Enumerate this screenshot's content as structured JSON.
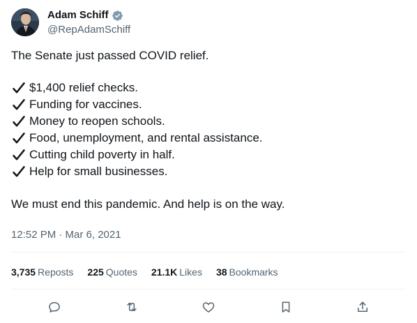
{
  "author": {
    "display_name": "Adam Schiff",
    "handle": "@RepAdamSchiff",
    "avatar_icon": "profile-photo",
    "verified_icon": "verified-badge-icon",
    "verified_color": "#829aab"
  },
  "tweet": {
    "intro": "The Senate just passed COVID relief.",
    "checklist": [
      "$1,400 relief checks.",
      "Funding for vaccines.",
      "Money to reopen schools.",
      "Food, unemployment, and rental assistance.",
      "Cutting child poverty in half.",
      "Help for small businesses."
    ],
    "check_icon": "heavy-check-mark-icon",
    "outro": "We must end this pandemic. And help is on the way."
  },
  "timestamp": "12:52 PM · Mar 6, 2021",
  "stats": {
    "reposts_count": "3,735",
    "reposts_label": "Reposts",
    "quotes_count": "225",
    "quotes_label": "Quotes",
    "likes_count": "21.1K",
    "likes_label": "Likes",
    "bookmarks_count": "38",
    "bookmarks_label": "Bookmarks"
  },
  "actions": [
    "reply-icon",
    "repost-icon",
    "like-icon",
    "bookmark-icon",
    "share-icon"
  ],
  "colors": {
    "text": "#0f1419",
    "secondary": "#536471",
    "divider": "#eff3f4"
  }
}
